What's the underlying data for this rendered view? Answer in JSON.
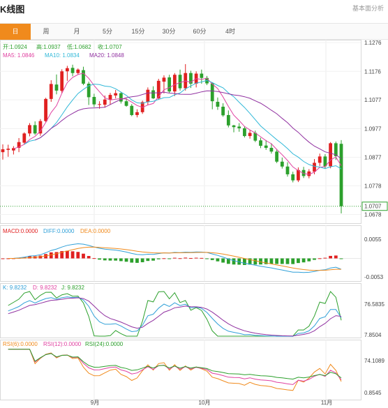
{
  "header": {
    "title": "K线图",
    "subtitle": "基本面分析"
  },
  "tabs": [
    {
      "label": "日",
      "active": true
    },
    {
      "label": "周",
      "active": false
    },
    {
      "label": "月",
      "active": false
    },
    {
      "label": "5分",
      "active": false
    },
    {
      "label": "15分",
      "active": false
    },
    {
      "label": "30分",
      "active": false
    },
    {
      "label": "60分",
      "active": false
    },
    {
      "label": "4时",
      "active": false
    }
  ],
  "legends": {
    "ohlc": {
      "open": "开:1.0924",
      "high": "高:1.0937",
      "low": "低:1.0682",
      "close": "收:1.0707"
    },
    "ma": {
      "ma5": "MA5: 1.0846",
      "ma10": "MA10: 1.0834",
      "ma20": "MA20: 1.0848"
    },
    "macd": {
      "macd": "MACD:0.0000",
      "diff": "DIFF:0.0000",
      "dea": "DEA:0.0000"
    },
    "kdj": {
      "k": "K: 9.8232",
      "d": "D: 9.8232",
      "j": "J: 9.8232"
    },
    "rsi": {
      "rsi6": "RSI(6):0.0000",
      "rsi12": "RSI(12):0.0000",
      "rsi24": "RSI(24):0.0000"
    }
  },
  "colors": {
    "up": "#e02020",
    "down": "#2ca02c",
    "ma5": "#e040a0",
    "ma10": "#30b8d8",
    "ma20": "#9030a0",
    "accent": "#f08a1c",
    "last_price_line": "#2ca02c"
  },
  "chart_data": {
    "type": "candlestick",
    "x_ticks": [
      "9月",
      "10月",
      "11月"
    ],
    "main_axis": {
      "ticks": [
        "1.1276",
        "1.1176",
        "1.1077",
        "1.0977",
        "1.0877",
        "1.0778",
        "1.0678"
      ],
      "ylim": [
        1.0653,
        1.1276
      ],
      "last_price_label": "1.0707"
    },
    "macd_axis": {
      "ticks": [
        "0.0055",
        "-0.0053"
      ]
    },
    "kdj_axis": {
      "ticks": [
        "76.5835",
        "7.8504"
      ]
    },
    "rsi_axis": {
      "ticks": [
        "74.1089",
        "0.8545"
      ]
    },
    "candles": [
      {
        "o": 1.0895,
        "h": 1.0922,
        "l": 1.0869,
        "c": 1.0905
      },
      {
        "o": 1.0903,
        "h": 1.0921,
        "l": 1.0879,
        "c": 1.0907
      },
      {
        "o": 1.0901,
        "h": 1.0916,
        "l": 1.0887,
        "c": 1.0909
      },
      {
        "o": 1.091,
        "h": 1.0944,
        "l": 1.0895,
        "c": 1.093
      },
      {
        "o": 1.0928,
        "h": 1.0964,
        "l": 1.0921,
        "c": 1.096
      },
      {
        "o": 1.096,
        "h": 1.0996,
        "l": 1.095,
        "c": 1.0989
      },
      {
        "o": 1.0989,
        "h": 1.1002,
        "l": 1.0955,
        "c": 1.096
      },
      {
        "o": 1.096,
        "h": 1.101,
        "l": 1.0952,
        "c": 1.1003
      },
      {
        "o": 1.1003,
        "h": 1.1084,
        "l": 1.0998,
        "c": 1.108
      },
      {
        "o": 1.108,
        "h": 1.1145,
        "l": 1.107,
        "c": 1.1132
      },
      {
        "o": 1.113,
        "h": 1.1165,
        "l": 1.1096,
        "c": 1.1109
      },
      {
        "o": 1.1108,
        "h": 1.1183,
        "l": 1.11,
        "c": 1.1176
      },
      {
        "o": 1.1176,
        "h": 1.1195,
        "l": 1.1143,
        "c": 1.1187
      },
      {
        "o": 1.1188,
        "h": 1.1199,
        "l": 1.1159,
        "c": 1.117
      },
      {
        "o": 1.117,
        "h": 1.1186,
        "l": 1.1166,
        "c": 1.1182
      },
      {
        "o": 1.118,
        "h": 1.1192,
        "l": 1.1128,
        "c": 1.1133
      },
      {
        "o": 1.1133,
        "h": 1.114,
        "l": 1.1059,
        "c": 1.1086
      },
      {
        "o": 1.1087,
        "h": 1.1098,
        "l": 1.1052,
        "c": 1.1061
      },
      {
        "o": 1.106,
        "h": 1.1072,
        "l": 1.1046,
        "c": 1.1062
      },
      {
        "o": 1.106,
        "h": 1.1092,
        "l": 1.105,
        "c": 1.1078
      },
      {
        "o": 1.1078,
        "h": 1.1101,
        "l": 1.106,
        "c": 1.1094
      },
      {
        "o": 1.1092,
        "h": 1.1111,
        "l": 1.1082,
        "c": 1.11
      },
      {
        "o": 1.11,
        "h": 1.1105,
        "l": 1.1064,
        "c": 1.1071
      },
      {
        "o": 1.1072,
        "h": 1.1082,
        "l": 1.1053,
        "c": 1.1056
      },
      {
        "o": 1.1056,
        "h": 1.1062,
        "l": 1.102,
        "c": 1.1024
      },
      {
        "o": 1.1024,
        "h": 1.1044,
        "l": 1.1016,
        "c": 1.1034
      },
      {
        "o": 1.1034,
        "h": 1.1074,
        "l": 1.1028,
        "c": 1.1069
      },
      {
        "o": 1.1069,
        "h": 1.112,
        "l": 1.106,
        "c": 1.1112
      },
      {
        "o": 1.111,
        "h": 1.1124,
        "l": 1.108,
        "c": 1.1082
      },
      {
        "o": 1.1082,
        "h": 1.115,
        "l": 1.1077,
        "c": 1.1143
      },
      {
        "o": 1.114,
        "h": 1.1162,
        "l": 1.1099,
        "c": 1.1154
      },
      {
        "o": 1.1155,
        "h": 1.1164,
        "l": 1.1101,
        "c": 1.1106
      },
      {
        "o": 1.1106,
        "h": 1.117,
        "l": 1.109,
        "c": 1.1164
      },
      {
        "o": 1.1164,
        "h": 1.1182,
        "l": 1.1109,
        "c": 1.1117
      },
      {
        "o": 1.1117,
        "h": 1.1201,
        "l": 1.1109,
        "c": 1.117
      },
      {
        "o": 1.117,
        "h": 1.1178,
        "l": 1.1118,
        "c": 1.1133
      },
      {
        "o": 1.1133,
        "h": 1.1176,
        "l": 1.112,
        "c": 1.1168
      },
      {
        "o": 1.1168,
        "h": 1.1182,
        "l": 1.1133,
        "c": 1.1153
      },
      {
        "o": 1.1153,
        "h": 1.116,
        "l": 1.1128,
        "c": 1.1134
      },
      {
        "o": 1.1134,
        "h": 1.1138,
        "l": 1.1044,
        "c": 1.1072
      },
      {
        "o": 1.107,
        "h": 1.1085,
        "l": 1.1042,
        "c": 1.1053
      },
      {
        "o": 1.1053,
        "h": 1.1065,
        "l": 1.1018,
        "c": 1.1023
      },
      {
        "o": 1.1024,
        "h": 1.104,
        "l": 1.0981,
        "c": 1.0988
      },
      {
        "o": 1.0988,
        "h": 1.099,
        "l": 1.0964,
        "c": 1.0982
      },
      {
        "o": 1.0984,
        "h": 1.0996,
        "l": 1.0966,
        "c": 1.0978
      },
      {
        "o": 1.0978,
        "h": 1.0985,
        "l": 1.0946,
        "c": 1.0951
      },
      {
        "o": 1.0951,
        "h": 1.0972,
        "l": 1.0942,
        "c": 1.0962
      },
      {
        "o": 1.0962,
        "h": 1.097,
        "l": 1.093,
        "c": 1.0935
      },
      {
        "o": 1.0936,
        "h": 1.0945,
        "l": 1.0909,
        "c": 1.0917
      },
      {
        "o": 1.0918,
        "h": 1.0937,
        "l": 1.0903,
        "c": 1.091
      },
      {
        "o": 1.091,
        "h": 1.0926,
        "l": 1.089,
        "c": 1.0897
      },
      {
        "o": 1.0897,
        "h": 1.0906,
        "l": 1.0857,
        "c": 1.0862
      },
      {
        "o": 1.0862,
        "h": 1.0876,
        "l": 1.0838,
        "c": 1.0845
      },
      {
        "o": 1.0845,
        "h": 1.086,
        "l": 1.081,
        "c": 1.0818
      },
      {
        "o": 1.0818,
        "h": 1.0827,
        "l": 1.079,
        "c": 1.0797
      },
      {
        "o": 1.0797,
        "h": 1.0842,
        "l": 1.0791,
        "c": 1.0833
      },
      {
        "o": 1.0833,
        "h": 1.0844,
        "l": 1.0805,
        "c": 1.0812
      },
      {
        "o": 1.0812,
        "h": 1.0836,
        "l": 1.0804,
        "c": 1.0828
      },
      {
        "o": 1.0827,
        "h": 1.0871,
        "l": 1.0818,
        "c": 1.0858
      },
      {
        "o": 1.0858,
        "h": 1.089,
        "l": 1.0846,
        "c": 1.088
      },
      {
        "o": 1.088,
        "h": 1.0888,
        "l": 1.0837,
        "c": 1.0846
      },
      {
        "o": 1.0846,
        "h": 1.093,
        "l": 1.0839,
        "c": 1.0926
      },
      {
        "o": 1.0926,
        "h": 1.0932,
        "l": 1.0868,
        "c": 1.0881
      },
      {
        "o": 1.0924,
        "h": 1.0937,
        "l": 1.0682,
        "c": 1.0707
      }
    ]
  }
}
